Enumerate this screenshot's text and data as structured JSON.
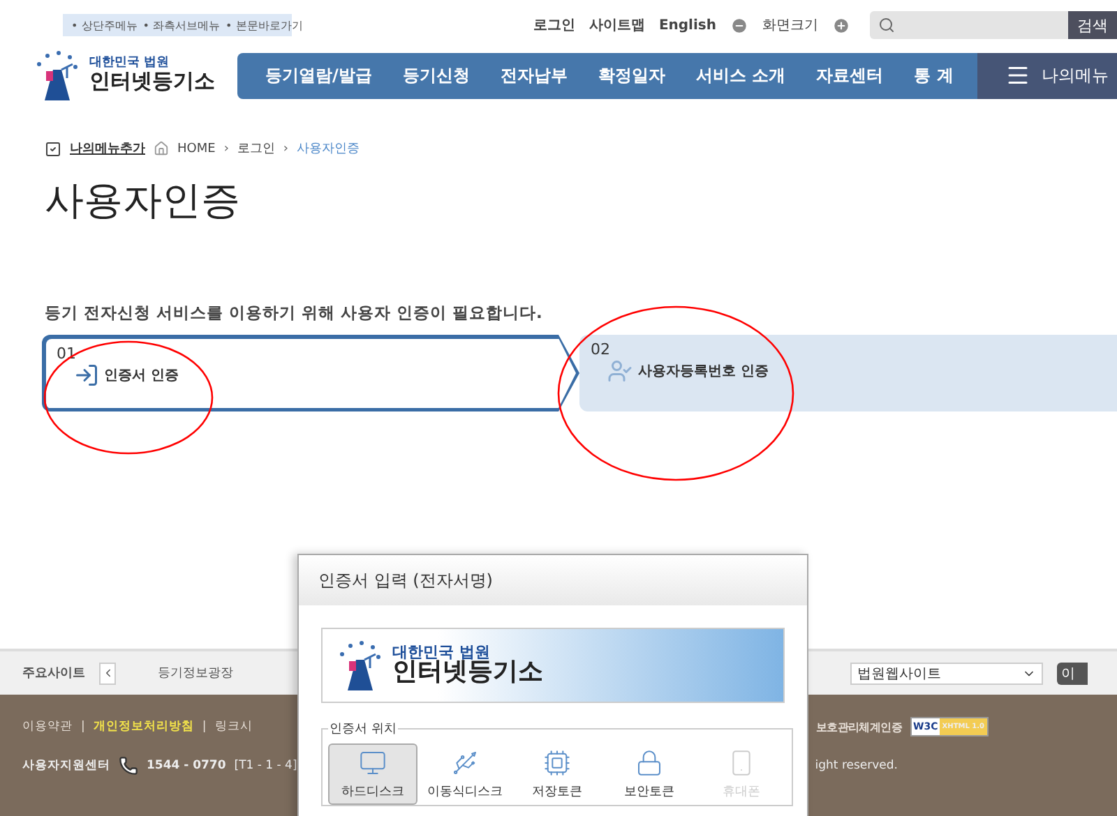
{
  "skip_links": [
    "• 상단주메뉴",
    "• 좌측서브메뉴",
    "• 본문바로가기"
  ],
  "utility_links": [
    "로그인",
    "사이트맵",
    "English"
  ],
  "zoom": {
    "label": "화면크기"
  },
  "search": {
    "button": "검색"
  },
  "logo": {
    "top": "대한민국 법원",
    "main": "인터넷등기소"
  },
  "nav": {
    "items": [
      "등기열람/발급",
      "등기신청",
      "전자납부",
      "확정일자",
      "서비스 소개",
      "자료센터",
      "통 계"
    ],
    "my_menu": "나의메뉴"
  },
  "breadcrumb": {
    "add_label": "나의메뉴추가",
    "separator": "›",
    "items": [
      {
        "label": "HOME",
        "selected": false
      },
      {
        "label": "로그인",
        "selected": false
      },
      {
        "label": "사용자인증",
        "selected": true
      }
    ]
  },
  "page_title": "사용자인증",
  "message": "등기 전자신청 서비스를 이용하기 위해 사용자 인증이 필요합니다.",
  "steps": [
    {
      "number": "01",
      "label": "인증서 인증",
      "kind": "certificate",
      "selected": true
    },
    {
      "number": "02",
      "label": "사용자등록번호 인증",
      "kind": "user",
      "selected": false
    }
  ],
  "footer": {
    "sites_label": "주요사이트",
    "site_links": [
      "등기정보광장"
    ],
    "site_select": "법원웹사이트",
    "go_button": "이",
    "link_separator": "|",
    "links": [
      {
        "label": "이용약관",
        "highlight": false
      },
      {
        "label": "개인정보처리방침",
        "highlight": true
      },
      {
        "label": "링크시",
        "highlight": false
      }
    ],
    "certification": "보호관리체계인증",
    "w3c_badge": {
      "mark": "W3C",
      "label": "XHTML 1.0"
    },
    "support_label": "사용자지원센터",
    "phone": "1544 - 0770",
    "phone_note": "[T1 - 1 - 4]",
    "copyright": "ight reserved."
  },
  "dialog": {
    "title": "인증서 입력 (전자서명)",
    "banner": {
      "top": "대한민국 법원",
      "main": "인터넷등기소"
    },
    "location_legend": "인증서 위치",
    "locations": [
      {
        "label": "하드디스크",
        "kind": "disk",
        "selected": true,
        "disabled": false
      },
      {
        "label": "이동식디스크",
        "kind": "usb",
        "selected": false,
        "disabled": false
      },
      {
        "label": "저장토큰",
        "kind": "token",
        "selected": false,
        "disabled": false
      },
      {
        "label": "보안토큰",
        "kind": "secure",
        "selected": false,
        "disabled": false
      },
      {
        "label": "휴대폰",
        "kind": "phone",
        "selected": false,
        "disabled": true
      }
    ]
  },
  "annotations": [
    {
      "kind": "freehand-circle",
      "color": "#ff0000"
    },
    {
      "kind": "freehand-circle",
      "color": "#ff0000"
    }
  ]
}
